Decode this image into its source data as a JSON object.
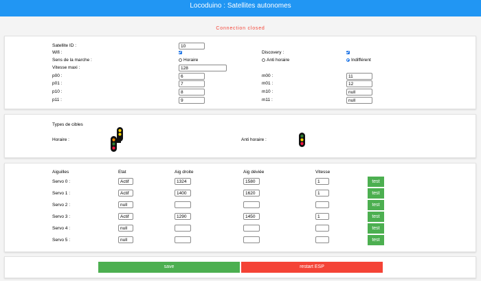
{
  "header": {
    "title": "Locoduino : Satellites autonomes"
  },
  "status": "Connection closed",
  "config": {
    "satellite_id_label": "Satellite ID :",
    "satellite_id": "10",
    "wifi_label": "Wifi :",
    "wifi_checked": true,
    "discovery_label": "Discovery :",
    "discovery_checked": true,
    "direction_label": "Sens de la marche :",
    "direction_options": [
      "Horaire",
      "Anti horaire",
      "Indifférent"
    ],
    "direction_selected": "Indifférent",
    "max_speed_label": "Vitesse maxi :",
    "max_speed": "128",
    "p_labels": [
      "p00 :",
      "p01 :",
      "p10 :",
      "p11 :"
    ],
    "p_values": [
      "6",
      "7",
      "8",
      "9"
    ],
    "m_labels": [
      "m00 :",
      "m01 :",
      "m10 :",
      "m11 :"
    ],
    "m_values": [
      "11",
      "12",
      "null",
      "null"
    ]
  },
  "targets": {
    "title": "Types de cibles",
    "clockwise_label": "Horaire :",
    "counter_clockwise_label": "Anti horaire :",
    "clockwise_signal_icon": "double-signal-icon",
    "counter_clockwise_signal_icon": "single-signal-icon"
  },
  "servos": {
    "headers": [
      "Aiguilles",
      "Etat",
      "Aig droite",
      "Aig déviée",
      "Vitesse"
    ],
    "test_label": "test",
    "rows": [
      {
        "label": "Servo 0 :",
        "etat": "Actif",
        "droite": "1324",
        "deviee": "1580",
        "vitesse": "1"
      },
      {
        "label": "Servo 1 :",
        "etat": "Actif",
        "droite": "1400",
        "deviee": "1620",
        "vitesse": "1"
      },
      {
        "label": "Servo 2 :",
        "etat": "null",
        "droite": "",
        "deviee": "",
        "vitesse": ""
      },
      {
        "label": "Servo 3 :",
        "etat": "Actif",
        "droite": "1290",
        "deviee": "1450",
        "vitesse": "1"
      },
      {
        "label": "Servo 4 :",
        "etat": "null",
        "droite": "",
        "deviee": "",
        "vitesse": ""
      },
      {
        "label": "Servo 5 :",
        "etat": "null",
        "droite": "",
        "deviee": "",
        "vitesse": ""
      }
    ]
  },
  "actions": {
    "save_label": "save",
    "restart_label": "restart ESP",
    "save_color": "#4caf50",
    "restart_color": "#f44336"
  }
}
